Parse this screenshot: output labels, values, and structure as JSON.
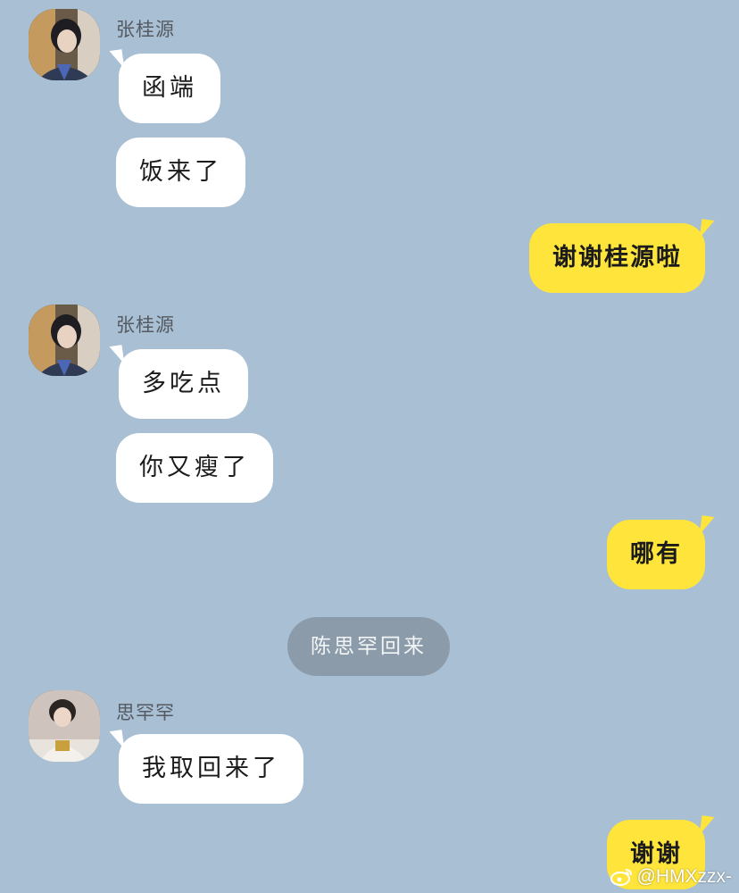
{
  "conversation": {
    "messages": [
      {
        "sender": "张桂源",
        "texts": [
          "函端",
          "饭来了"
        ]
      },
      {
        "sender": "me",
        "texts": [
          "谢谢桂源啦"
        ]
      },
      {
        "sender": "张桂源",
        "texts": [
          "多吃点",
          "你又瘦了"
        ]
      },
      {
        "sender": "me",
        "texts": [
          "哪有"
        ]
      },
      {
        "system": "陈思罕回来"
      },
      {
        "sender": "思罕罕",
        "texts": [
          "我取回来了"
        ]
      },
      {
        "sender": "me",
        "texts": [
          "谢谢"
        ]
      }
    ]
  },
  "watermark": {
    "text": "@HMXzzx-",
    "icon": "weibo-icon"
  },
  "colors": {
    "background": "#a9bfd3",
    "incoming_bubble": "#ffffff",
    "outgoing_bubble": "#ffe53b",
    "system_pill": "#8c9ba9"
  }
}
